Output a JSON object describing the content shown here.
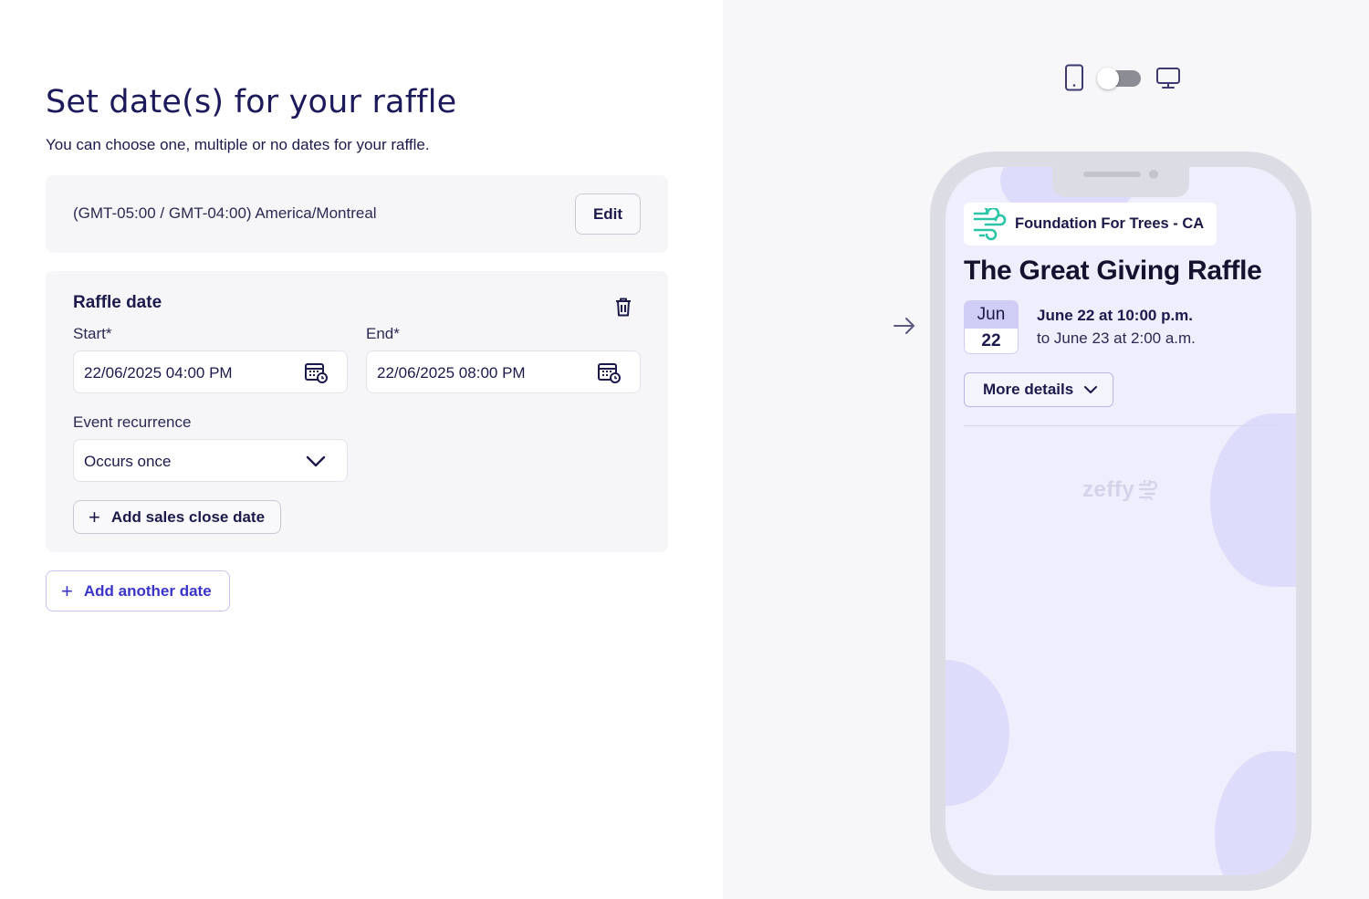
{
  "left": {
    "title": "Set date(s) for your raffle",
    "subtitle": "You can choose one, multiple or no dates for your raffle.",
    "timezone": {
      "text": "(GMT-05:00 / GMT-04:00) America/Montreal",
      "edit_label": "Edit"
    },
    "raffle_date": {
      "title": "Raffle date",
      "start_label": "Start*",
      "start_value": "22/06/2025 04:00 PM",
      "end_label": "End*",
      "end_value": "22/06/2025 08:00 PM",
      "recurrence_label": "Event recurrence",
      "recurrence_value": "Occurs once",
      "add_sales_close_label": "Add sales close date"
    },
    "add_another_label": "Add another date"
  },
  "preview": {
    "org_name": "Foundation For Trees - CA",
    "event_title": "The Great Giving Raffle",
    "date_badge": {
      "month": "Jun",
      "day": "22"
    },
    "when_line1": "June 22 at 10:00 p.m.",
    "when_line2": "to June 23 at 2:00 a.m.",
    "more_details_label": "More details",
    "brand_watermark": "zeffy"
  },
  "colors": {
    "primary_text": "#1c1a4a",
    "accent": "#3a35c8",
    "logo_teal": "#2bc4a6",
    "preview_bg": "#eeeefc"
  },
  "icons": [
    "trash-icon",
    "calendar-icon",
    "chevron-down-icon",
    "plus-icon",
    "mobile-icon",
    "desktop-icon",
    "arrow-right-icon"
  ]
}
